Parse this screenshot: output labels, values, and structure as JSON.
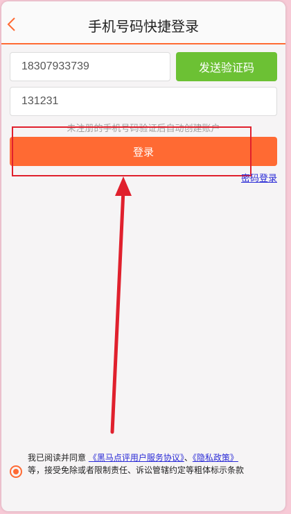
{
  "header": {
    "title": "手机号码快捷登录",
    "back_icon": "chevron-left-icon"
  },
  "form": {
    "phone_value": "18307933739",
    "send_code_label": "发送验证码",
    "code_value": "131231",
    "hint": "未注册的手机号码验证后自动创建账户",
    "login_label": "登录",
    "password_login_link": "密码登录"
  },
  "agreement": {
    "prefix": "我已阅读并同意",
    "service_link": "《黑马点评用户服务协议》",
    "separator": "、",
    "privacy_link": "《隐私政策》",
    "suffix": "等，接受免除或者限制责任、诉讼管辖约定等粗体标示条款"
  },
  "colors": {
    "accent": "#ff6a33",
    "send_button": "#6cc134",
    "annotation": "#e0202d",
    "link": "#2b2bd6"
  }
}
